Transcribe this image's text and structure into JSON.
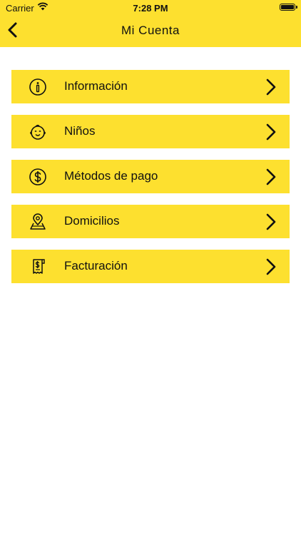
{
  "status_bar": {
    "carrier": "Carrier",
    "time": "7:28 PM"
  },
  "nav": {
    "title": "Mi Cuenta",
    "back_icon": "chevron-left-icon"
  },
  "menu": {
    "items": [
      {
        "label": "Información",
        "icon": "info-icon"
      },
      {
        "label": "Niños",
        "icon": "baby-face-icon"
      },
      {
        "label": "Métodos de pago",
        "icon": "dollar-coin-icon"
      },
      {
        "label": "Domicilios",
        "icon": "map-pin-icon"
      },
      {
        "label": "Facturación",
        "icon": "receipt-icon"
      }
    ]
  },
  "colors": {
    "accent": "#fde02f",
    "text": "#111111",
    "background": "#ffffff"
  }
}
